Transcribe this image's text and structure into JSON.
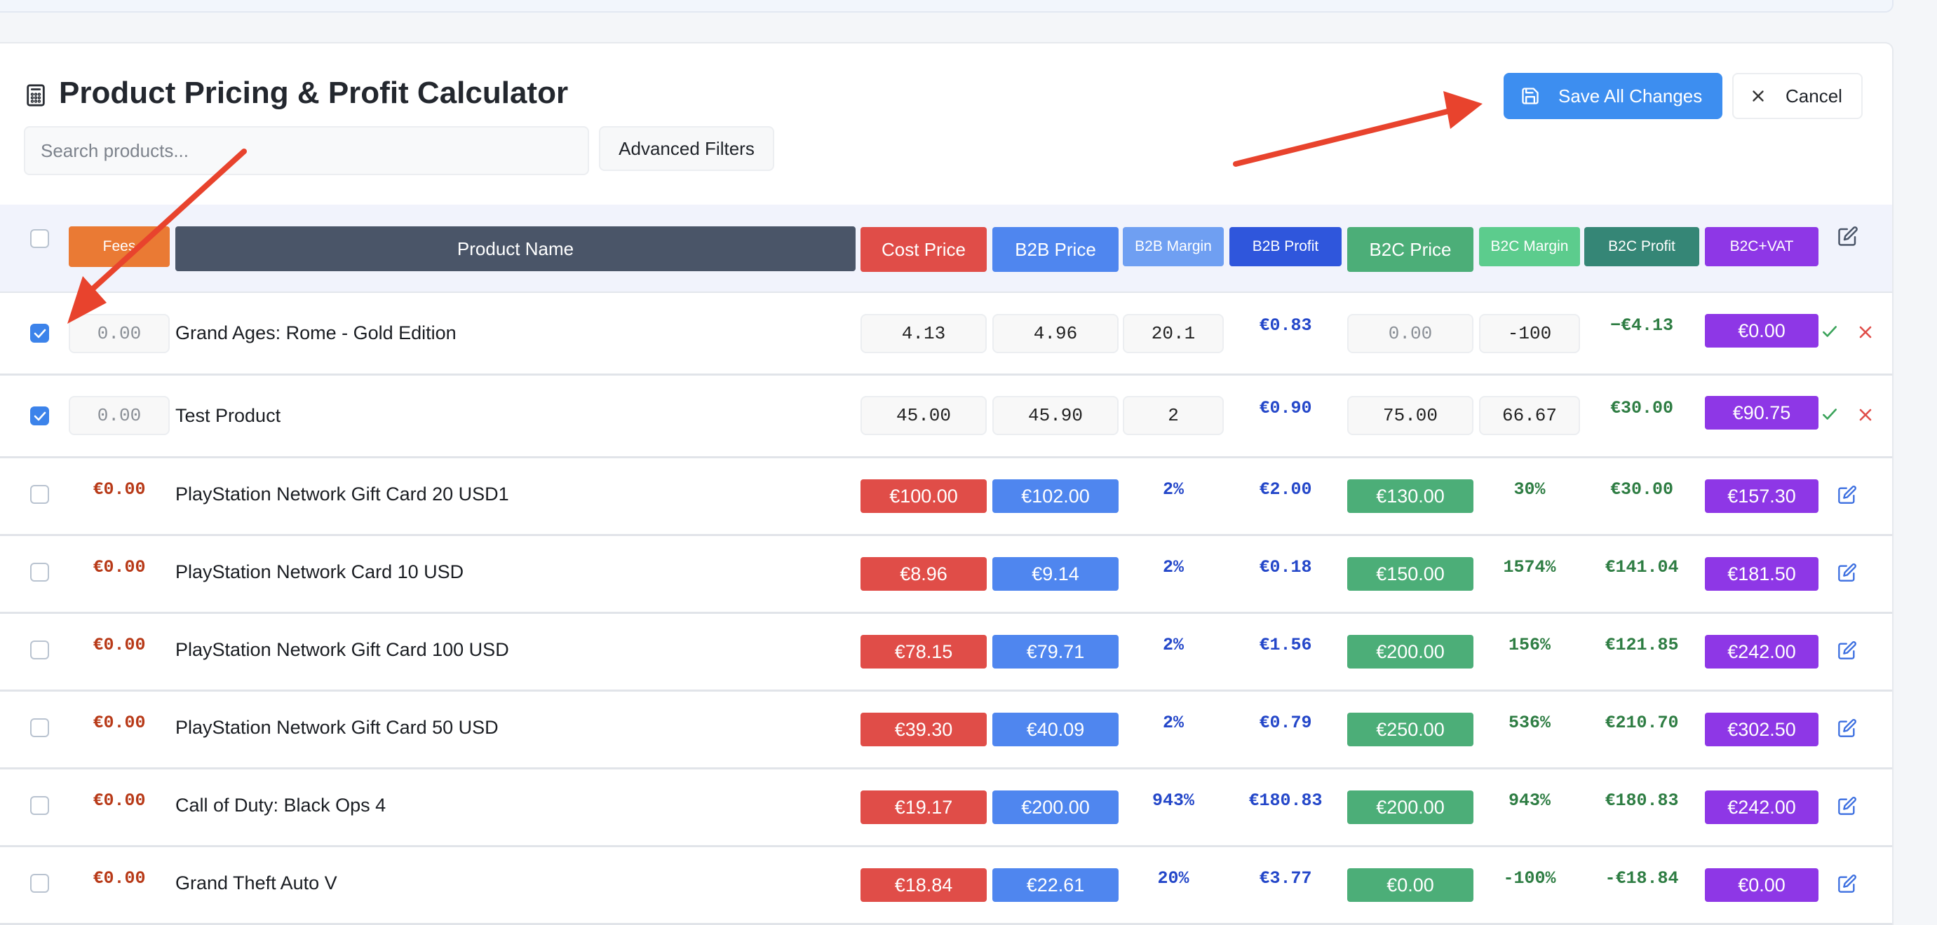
{
  "page": {
    "title": "Product Pricing & Profit Calculator",
    "search_placeholder": "Search products...",
    "advanced_filters_label": "Advanced Filters",
    "save_label": "Save All Changes",
    "cancel_label": "Cancel"
  },
  "table": {
    "headers": {
      "fees": "Fees",
      "product_name": "Product Name",
      "cost_price": "Cost Price",
      "b2b_price": "B2B Price",
      "b2b_margin": "B2B Margin",
      "b2b_profit": "B2B Profit",
      "b2c_price": "B2C Price",
      "b2c_margin": "B2C Margin",
      "b2c_profit": "B2C Profit",
      "b2c_vat": "B2C+VAT"
    },
    "editing_rows": [
      {
        "checked": true,
        "fees": "0.00",
        "name": "Grand Ages: Rome - Gold Edition",
        "cost": "4.13",
        "b2b_price": "4.96",
        "b2b_margin": "20.1",
        "b2b_profit": "€0.83",
        "b2c_price": "0.00",
        "b2c_margin": "-100",
        "b2c_profit": "−€4.13",
        "b2c_vat": "€0.00"
      },
      {
        "checked": true,
        "fees": "0.00",
        "name": "Test Product",
        "cost": "45.00",
        "b2b_price": "45.90",
        "b2b_margin": "2",
        "b2b_profit": "€0.90",
        "b2c_price": "75.00",
        "b2c_margin": "66.67",
        "b2c_profit": "€30.00",
        "b2c_vat": "€90.75"
      }
    ],
    "rows": [
      {
        "fees": "€0.00",
        "name": "PlayStation Network Gift Card 20 USD1",
        "cost": "€100.00",
        "b2b_price": "€102.00",
        "b2b_margin": "2%",
        "b2b_profit": "€2.00",
        "b2c_price": "€130.00",
        "b2c_margin": "30%",
        "b2c_profit": "€30.00",
        "b2c_vat": "€157.30"
      },
      {
        "fees": "€0.00",
        "name": "PlayStation Network Card 10 USD",
        "cost": "€8.96",
        "b2b_price": "€9.14",
        "b2b_margin": "2%",
        "b2b_profit": "€0.18",
        "b2c_price": "€150.00",
        "b2c_margin": "1574%",
        "b2c_profit": "€141.04",
        "b2c_vat": "€181.50"
      },
      {
        "fees": "€0.00",
        "name": "PlayStation Network Gift Card 100 USD",
        "cost": "€78.15",
        "b2b_price": "€79.71",
        "b2b_margin": "2%",
        "b2b_profit": "€1.56",
        "b2c_price": "€200.00",
        "b2c_margin": "156%",
        "b2c_profit": "€121.85",
        "b2c_vat": "€242.00"
      },
      {
        "fees": "€0.00",
        "name": "PlayStation Network Gift Card 50 USD",
        "cost": "€39.30",
        "b2b_price": "€40.09",
        "b2b_margin": "2%",
        "b2b_profit": "€0.79",
        "b2c_price": "€250.00",
        "b2c_margin": "536%",
        "b2c_profit": "€210.70",
        "b2c_vat": "€302.50"
      },
      {
        "fees": "€0.00",
        "name": "Call of Duty: Black Ops 4",
        "cost": "€19.17",
        "b2b_price": "€200.00",
        "b2b_margin": "943%",
        "b2b_profit": "€180.83",
        "b2c_price": "€200.00",
        "b2c_margin": "943%",
        "b2c_profit": "€180.83",
        "b2c_vat": "€242.00"
      },
      {
        "fees": "€0.00",
        "name": "Grand Theft Auto V",
        "cost": "€18.84",
        "b2b_price": "€22.61",
        "b2b_margin": "20%",
        "b2b_profit": "€3.77",
        "b2c_price": "€0.00",
        "b2c_margin": "-100%",
        "b2c_profit": "-€18.84",
        "b2c_vat": "€0.00"
      }
    ]
  },
  "colors": {
    "accent": "#3d8ef0",
    "annotation_arrow": "#e8432d"
  }
}
